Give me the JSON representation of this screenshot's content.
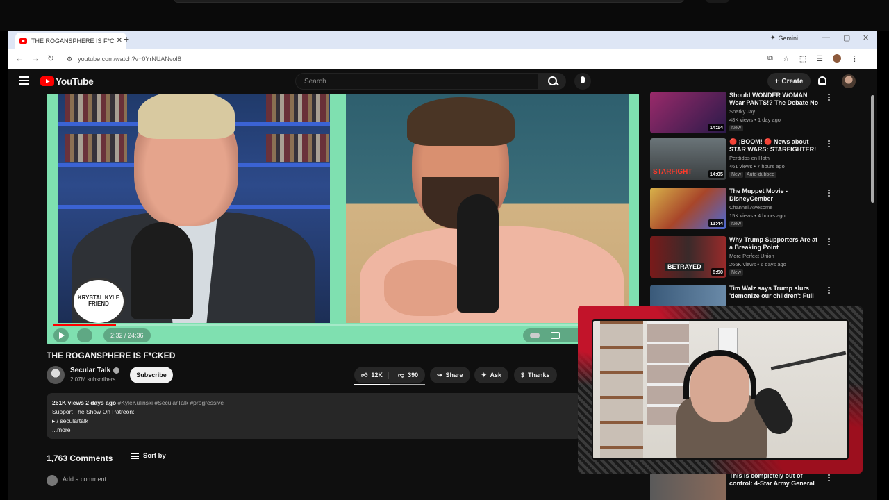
{
  "browser": {
    "tab_title": "THE ROGANSPHERE IS F*CKED",
    "new_tab": "+",
    "tab_close": "✕",
    "url": "youtube.com/watch?v=0YrNUANvoI8",
    "gemini_label": "Gemini",
    "nav": {
      "back": "←",
      "forward": "→",
      "reload": "↻",
      "tune": "⚙"
    },
    "window_controls": {
      "minimize": "—",
      "maximize": "▢",
      "close": "✕"
    }
  },
  "youtube": {
    "logo": "YouTube",
    "search_placeholder": "Search",
    "create_label": "Create"
  },
  "video": {
    "title": "THE ROGANSPHERE IS F*CKED",
    "time": "2:32 / 24:36",
    "progress": 0.108,
    "badge_text": "KRYSTAL KYLE FRIEND",
    "channel": "Secular Talk",
    "subscribers": "2.07M subscribers",
    "subscribe_label": "Subscribe",
    "likes": "12K",
    "dislikes": "390",
    "share": "Share",
    "ask": "Ask",
    "thanks": "Thanks"
  },
  "description": {
    "views_date": "261K views  2 days ago",
    "tags": "#KyleKulinski #SecularTalk #progressive",
    "line1": "Support The Show On Patreon:",
    "link": "▸ / seculartalk",
    "more": "...more"
  },
  "comments": {
    "count": "1,763 Comments",
    "sort_label": "Sort by",
    "add_placeholder": "Add a comment..."
  },
  "sidebar": {
    "items": [
      {
        "title": "Should WONDER WOMAN Wear PANTS!? The Debate No One ...",
        "channel": "Snarky Jay",
        "meta": "48K views • 1 day ago",
        "duration": "14:14",
        "badge": "New",
        "badge2": "",
        "color": "#7a2d6a"
      },
      {
        "title": "🔴 ¡BOOM! 🔴 News about STAR WARS: STARFIGHTER! 😱",
        "channel": "Perdidos en Hoth",
        "meta": "461 views • 7 hours ago",
        "duration": "14:05",
        "badge": "New",
        "badge2": "Auto-dubbed",
        "color": "#5a5e60"
      },
      {
        "title": "The Muppet Movie - DisneyCember",
        "channel": "Channel Awesome",
        "meta": "15K views • 4 hours ago",
        "duration": "11:44",
        "badge": "New",
        "badge2": "",
        "color": "#c9a24c"
      },
      {
        "title": "Why Trump Supporters Are at a Breaking Point",
        "channel": "More Perfect Union",
        "meta": "266K views • 6 days ago",
        "duration": "8:50",
        "badge": "New",
        "badge2": "",
        "color": "#8a1a1a"
      },
      {
        "title": "Tim Walz says Trump slurs 'demonize our children': Full ...",
        "channel": "",
        "meta": "",
        "duration": "",
        "badge": "",
        "badge2": "",
        "color": "#4a6a8a"
      },
      {
        "title": "This is completely out of control: 4-Star Army General ...",
        "channel": "",
        "meta": "",
        "duration": "",
        "badge": "",
        "badge2": "",
        "color": "#555"
      }
    ],
    "thumb_texts": {
      "item1": "STARFIGHT",
      "item3": "BETRAYED"
    }
  },
  "colors": {
    "player_bg": "#7fe0b0",
    "yt_red": "#ff0000",
    "page_bg": "#0f0f0f"
  }
}
